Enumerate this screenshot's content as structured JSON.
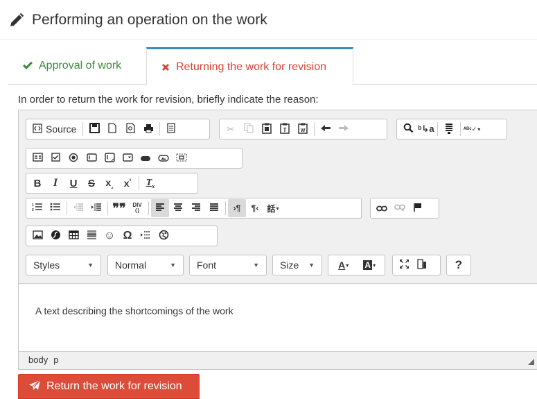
{
  "header": {
    "title": "Performing an operation on the work",
    "icon": "pencil-icon"
  },
  "tabs": [
    {
      "label": "Approval of work",
      "icon": "check-icon",
      "color": "#3c8b3c",
      "active": false
    },
    {
      "label": "Returning the work for revision",
      "icon": "times-icon",
      "color": "#d9433a",
      "active": true
    }
  ],
  "instruction": "In order to return the work for revision, briefly indicate the reason:",
  "editor": {
    "source_label": "Source",
    "styles_label": "Styles",
    "format_label": "Normal",
    "font_label": "Font",
    "size_label": "Size",
    "help_label": "?",
    "bold": "B",
    "italic": "I",
    "underline": "U",
    "strike": "S",
    "content_text": "A text describing the shortcomings of the work",
    "path": [
      "body",
      "p"
    ]
  },
  "submit": {
    "label": "Return the work for revision",
    "color": "#dd4b39"
  }
}
